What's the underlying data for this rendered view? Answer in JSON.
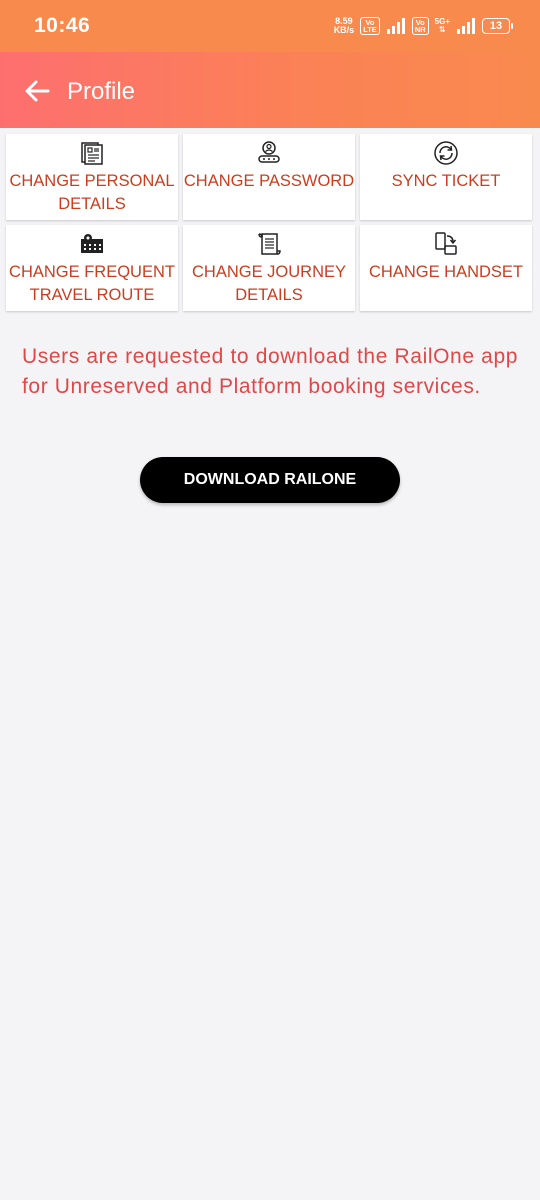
{
  "status_bar": {
    "time": "10:46",
    "speed_value": "8.59",
    "speed_unit": "KB/s",
    "volte1_top": "Vo",
    "volte1_bottom": "LTE",
    "volte2_top": "Vo",
    "volte2_bottom": "NR",
    "net_type": "5G+",
    "battery": "13"
  },
  "app_bar": {
    "title": "Profile",
    "back_icon": "arrow-left-icon",
    "background": "#fb7a5a"
  },
  "menu": {
    "items": [
      {
        "label": "CHANGE PERSONAL\nDETAILS",
        "icon": "personal-details-icon"
      },
      {
        "label": "CHANGE PASSWORD",
        "icon": "password-user-icon"
      },
      {
        "label": "SYNC TICKET",
        "icon": "sync-icon"
      },
      {
        "label": "CHANGE FREQUENT\nTRAVEL ROUTE",
        "icon": "route-map-icon"
      },
      {
        "label": "CHANGE JOURNEY\nDETAILS",
        "icon": "scroll-document-icon"
      },
      {
        "label": "CHANGE HANDSET",
        "icon": "handset-swap-icon"
      }
    ],
    "label_color": "#cc3d1d"
  },
  "notice": {
    "text": "Users are requested to download the RailOne app for Unreserved and Platform booking services.",
    "color": "#e04848"
  },
  "download_button": {
    "label": "DOWNLOAD RAILONE"
  }
}
